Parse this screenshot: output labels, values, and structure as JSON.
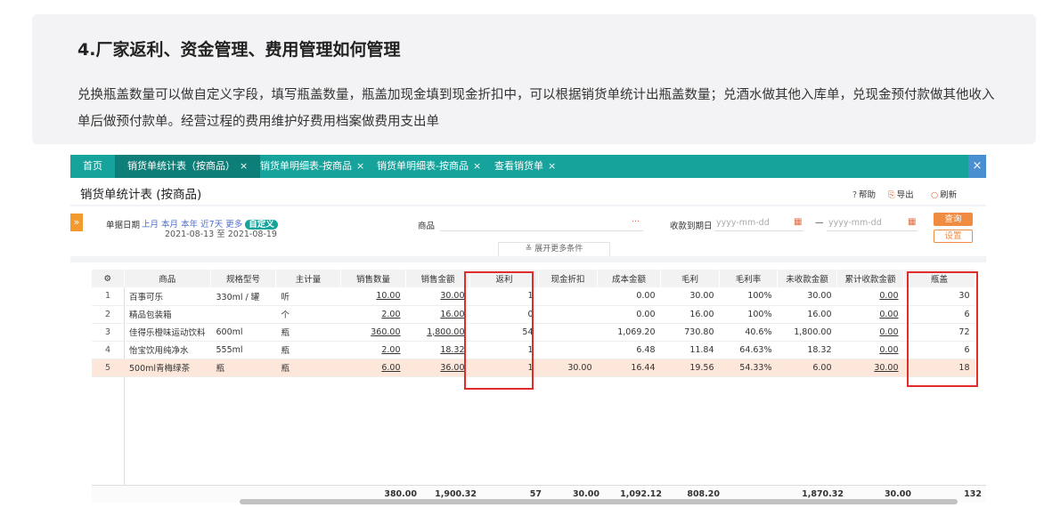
{
  "article": {
    "heading": "4.厂家返利、资金管理、费用管理如何管理",
    "body": "兑换瓶盖数量可以做自定义字段，填写瓶盖数量，瓶盖加现金填到现金折扣中，可以根据销货单统计出瓶盖数量；兑酒水做其他入库单，兑现金预付款做其他收入单后做预付款单。经营过程的费用维护好费用档案做费用支出单"
  },
  "tabs": {
    "home": "首页",
    "t1": "销货单统计表（按商品）",
    "t2": "销货单明细表-按商品",
    "t3": "销货单明细表-按商品",
    "t4": "查看销货单",
    "x": "×"
  },
  "page": {
    "title": "销货单统计表 (按商品)",
    "help": "帮助",
    "export": "导出",
    "refresh": "刷新"
  },
  "filter": {
    "date_label": "单据日期",
    "quick": [
      "上月",
      "本月",
      "本年",
      "近7天",
      "更多"
    ],
    "custom": "自定义",
    "range": "2021-08-13 至 2021-08-19",
    "goods_label": "商品",
    "goods_dots": "···",
    "due_label": "收款到期日",
    "date_placeholder": "yyyy-mm-dd",
    "dash": "—",
    "query": "查询",
    "settings": "设置",
    "more": "展开更多条件"
  },
  "table": {
    "headers": [
      "商品",
      "规格型号",
      "主计量",
      "销售数量",
      "销售金额",
      "返利",
      "现金折扣",
      "成本金额",
      "毛利",
      "毛利率",
      "未收款金额",
      "累计收款金额",
      "瓶盖"
    ],
    "rows": [
      {
        "no": "1",
        "name": "百事可乐",
        "spec": "330ml / 罐",
        "unit": "听",
        "qty": "10.00",
        "amount": "30.00",
        "rebate": "1",
        "cash": "",
        "cost": "0.00",
        "profit": "30.00",
        "rate": "100%",
        "unpaid": "30.00",
        "paid": "0.00",
        "caps": "30"
      },
      {
        "no": "2",
        "name": "精品包装箱",
        "spec": "",
        "unit": "个",
        "qty": "2.00",
        "amount": "16.00",
        "rebate": "0",
        "cash": "",
        "cost": "0.00",
        "profit": "16.00",
        "rate": "100%",
        "unpaid": "16.00",
        "paid": "0.00",
        "caps": "6"
      },
      {
        "no": "3",
        "name": "佳得乐橙味运动饮料",
        "spec": "600ml",
        "unit": "瓶",
        "qty": "360.00",
        "amount": "1,800.00",
        "rebate": "54",
        "cash": "",
        "cost": "1,069.20",
        "profit": "730.80",
        "rate": "40.6%",
        "unpaid": "1,800.00",
        "paid": "0.00",
        "caps": "72"
      },
      {
        "no": "4",
        "name": "怡宝饮用纯净水",
        "spec": "555ml",
        "unit": "瓶",
        "qty": "2.00",
        "amount": "18.32",
        "rebate": "1",
        "cash": "",
        "cost": "6.48",
        "profit": "11.84",
        "rate": "64.63%",
        "unpaid": "18.32",
        "paid": "0.00",
        "caps": "6"
      },
      {
        "no": "5",
        "name": "500ml青梅绿茶",
        "spec": "瓶",
        "unit": "瓶",
        "qty": "6.00",
        "amount": "36.00",
        "rebate": "1",
        "cash": "30.00",
        "cost": "16.44",
        "profit": "19.56",
        "rate": "54.33%",
        "unpaid": "6.00",
        "paid": "30.00",
        "caps": "18"
      }
    ],
    "totals": {
      "qty": "380.00",
      "amount": "1,900.32",
      "rebate": "57",
      "cash": "30.00",
      "cost": "1,092.12",
      "profit": "808.20",
      "unpaid": "1,870.32",
      "paid": "30.00",
      "caps": "132"
    }
  },
  "colors": {
    "tab_bar": "#16a39b",
    "accent": "#f08c42",
    "highlight_box": "#e12c2c",
    "selected_row": "#fde7da"
  }
}
